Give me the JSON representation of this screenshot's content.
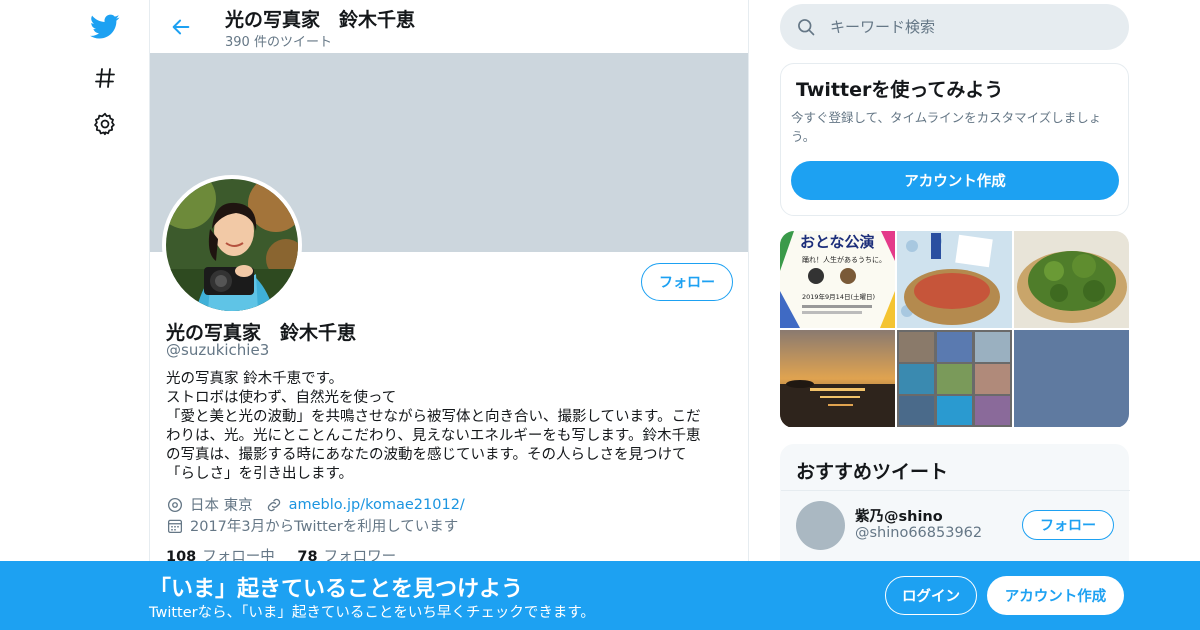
{
  "nav": {
    "items": [
      {
        "icon": "twitter-logo-icon"
      },
      {
        "icon": "hashtag-icon"
      },
      {
        "icon": "gear-icon"
      }
    ],
    "brand_color": "#1da1f2"
  },
  "header": {
    "title": "光の写真家　鈴木千恵",
    "tweet_count": "390 件のツイート"
  },
  "profile": {
    "name": "光の写真家　鈴木千恵",
    "handle": "@suzukichie3",
    "follow_label": "フォロー",
    "bio_lines": [
      "光の写真家 鈴木千恵です。",
      "ストロボは使わず、自然光を使って",
      "「愛と美と光の波動」を共鳴させながら被写体と向き合い、撮影しています。こだ",
      "わりは、光。光にとことんこだわり、見えないエネルギーをも写します。鈴木千恵",
      "の写真は、撮影する時にあなたの波動を感じています。その人らしさを見つけて",
      "「らしさ」を引き出します。"
    ],
    "location": "日本 東京",
    "website": "ameblo.jp/komae21012/",
    "joined": "2017年3月からTwitterを利用しています",
    "following_count": "108",
    "following_label": "フォロー中",
    "followers_count": "78",
    "followers_label": "フォロワー"
  },
  "search": {
    "placeholder": "キーワード検索"
  },
  "try_card": {
    "title": "Twitterを使ってみよう",
    "description": "今すぐ登録して、タイムラインをカスタマイズしましょう。",
    "button": "アカウント作成"
  },
  "media": {
    "poster_title": "おとな公演",
    "poster_tagline": "踊れ！人生があるうちに。",
    "poster_date": "2019年9月14日(土曜日)"
  },
  "recommended": {
    "title": "おすすめツイート",
    "user": {
      "name": "紫乃@shino",
      "handle": "@shino66853962",
      "follow_label": "フォロー"
    }
  },
  "bottom_bar": {
    "headline": "「いま」起きていることを見つけよう",
    "subtext": "Twitterなら、「いま」起きていることをいち早くチェックできます。",
    "login": "ログイン",
    "signup": "アカウント作成"
  }
}
